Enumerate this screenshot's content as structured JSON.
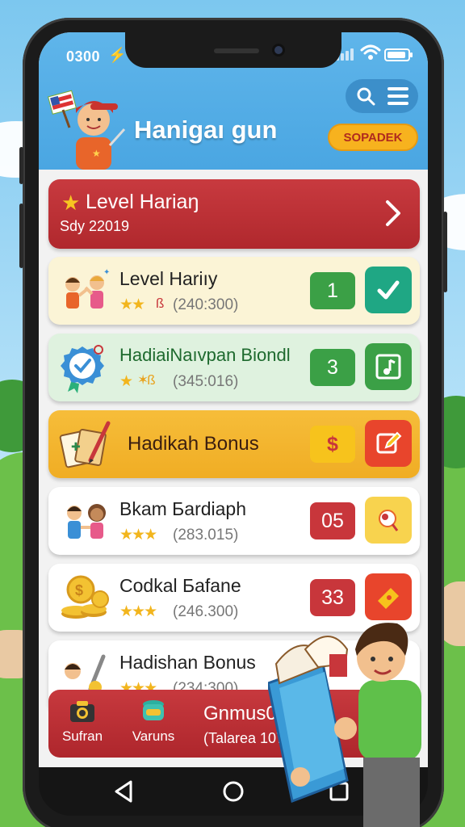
{
  "status_bar": {
    "time": "0300"
  },
  "header": {
    "title": "Hanigaı gun",
    "special_button": "SOPADEK"
  },
  "daily_banner": {
    "title": "Level Hariaŋ",
    "date": "Sdy 22019"
  },
  "rows": [
    {
      "title": "Level Hariıy",
      "stars": "★★",
      "extra": "ß",
      "score": "(240:300)",
      "count": "1",
      "action_icon": "check-icon"
    },
    {
      "title": "HadiaiNaıvpan Biondl",
      "stars": "★",
      "extra": "✶ß",
      "score": "(345:016)",
      "count": "3",
      "action_icon": "music-note-icon"
    },
    {
      "title": "Hadikah Bonus",
      "count": "$",
      "action_icon": "edit-icon"
    },
    {
      "title": "Bkam Бardiaph",
      "stars": "★★★",
      "score": "(283.015)",
      "count": "05",
      "action_icon": "magnifier-icon"
    },
    {
      "title": "Codkal Бafane",
      "stars": "★★★",
      "score": "(246.300)",
      "count": "33",
      "action_icon": "ticket-icon"
    },
    {
      "title": "Hadishan Bonus",
      "stars": "★★★",
      "score": "(234:300)"
    }
  ],
  "bottom_bar": {
    "tab1": "Sufran",
    "tab2": "Varuns",
    "bonus_code": "Gnmus09",
    "bonus_sub": "(Talarea 107)"
  },
  "colors": {
    "header": "#4aa6e2",
    "red": "#c8363b",
    "green": "#3ba046",
    "gold": "#f7b21e"
  }
}
